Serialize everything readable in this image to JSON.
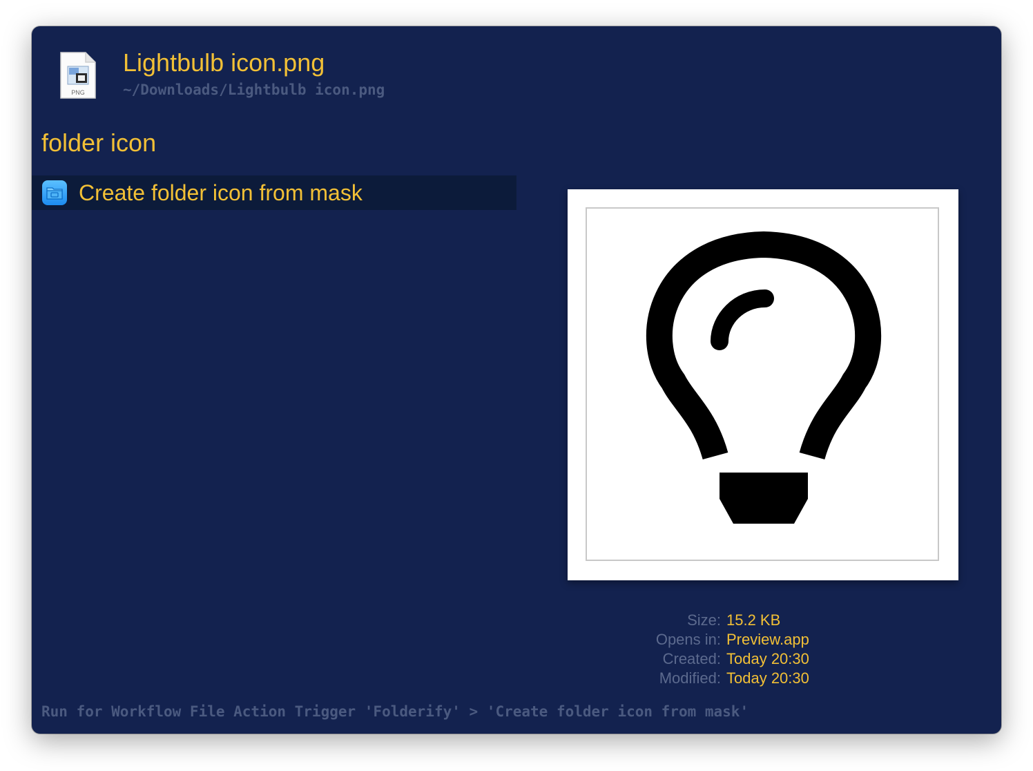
{
  "header": {
    "file_icon": "png-file-icon",
    "file_icon_label": "PNG",
    "title": "Lightbulb icon.png",
    "path": "~/Downloads/Lightbulb icon.png"
  },
  "query": "folder icon",
  "results": [
    {
      "icon": "folder-icon",
      "label": "Create folder icon from mask",
      "selected": true
    }
  ],
  "preview": {
    "image": "lightbulb-icon"
  },
  "info": [
    {
      "key": "Size:",
      "value": "15.2 KB"
    },
    {
      "key": "Opens in:",
      "value": "Preview.app"
    },
    {
      "key": "Created:",
      "value": "Today 20:30"
    },
    {
      "key": "Modified:",
      "value": "Today 20:30"
    }
  ],
  "footer": "Run for Workflow File Action Trigger 'Folderify' > 'Create folder icon from mask'",
  "colors": {
    "background": "#13224f",
    "accent": "#f2c036",
    "muted": "#4b5a80",
    "selection": "#0c1b3a"
  }
}
